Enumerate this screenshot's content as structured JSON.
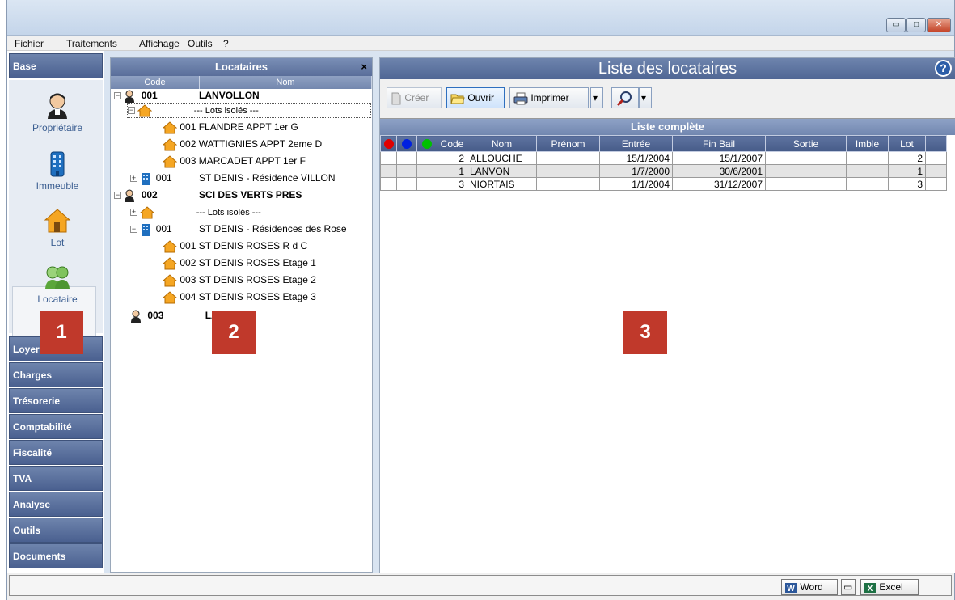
{
  "window": {
    "minimize": "▭",
    "maximize": "□",
    "close": "✕"
  },
  "menu": [
    "Fichier",
    "Traitements",
    "Affichage",
    "Outils",
    "?"
  ],
  "nav": {
    "base_label": "Base",
    "items": [
      {
        "label": "Propriétaire",
        "icon": "owner-icon"
      },
      {
        "label": "Immeuble",
        "icon": "building-icon"
      },
      {
        "label": "Lot",
        "icon": "house-icon"
      },
      {
        "label": "Locataire",
        "icon": "tenants-icon"
      }
    ],
    "sections": [
      "Loyers",
      "Charges",
      "Trésorerie",
      "Comptabilité",
      "Fiscalité",
      "TVA",
      "Analyse",
      "Outils",
      "Documents"
    ]
  },
  "tree": {
    "title": "Locataires",
    "close": "×",
    "col_code": "Code",
    "col_nom": "Nom",
    "rows": [
      {
        "code": "001",
        "name": "LANVOLLON"
      },
      {
        "name": "--- Lots isolés ---"
      },
      {
        "name": "001 FLANDRE APPT 1er G"
      },
      {
        "name": "002 WATTIGNIES APPT 2eme D"
      },
      {
        "name": "003 MARCADET APPT 1er F"
      },
      {
        "code": "001",
        "name": "ST DENIS - Résidence VILLON"
      },
      {
        "code": "002",
        "name": "SCI DES VERTS PRES"
      },
      {
        "name": "--- Lots isolés ---"
      },
      {
        "code": "001",
        "name": "ST DENIS - Résidences des Rose"
      },
      {
        "name": "001 ST DENIS ROSES R d C"
      },
      {
        "name": "002 ST DENIS ROSES Etage 1"
      },
      {
        "name": "003 ST DENIS ROSES Etage 2"
      },
      {
        "name": "004 ST DENIS ROSES Etage 3"
      },
      {
        "code": "003",
        "name": "LA"
      }
    ]
  },
  "main": {
    "title": "Liste des locataires",
    "help": "?",
    "toolbar": {
      "create": "Créer",
      "open": "Ouvrir",
      "print": "Imprimer",
      "dropdown": "▾"
    },
    "list_title": "Liste complète",
    "columns": [
      "Code",
      "Nom",
      "Prénom",
      "Entrée",
      "Fin Bail",
      "Sortie",
      "Imble",
      "Lot"
    ],
    "status_colors": [
      "#e00000",
      "#0020e0",
      "#00c000"
    ],
    "rows": [
      {
        "code": "2",
        "nom": "ALLOUCHE",
        "prenom": "",
        "entree": "15/1/2004",
        "fin": "15/1/2007",
        "sortie": "",
        "imble": "",
        "lot": "2"
      },
      {
        "code": "1",
        "nom": "LANVON",
        "prenom": "",
        "entree": "1/7/2000",
        "fin": "30/6/2001",
        "sortie": "",
        "imble": "",
        "lot": "1"
      },
      {
        "code": "3",
        "nom": "NIORTAIS",
        "prenom": "",
        "entree": "1/1/2004",
        "fin": "31/12/2007",
        "sortie": "",
        "imble": "",
        "lot": "3"
      }
    ]
  },
  "status": {
    "word": "Word",
    "excel": "Excel"
  },
  "badges": [
    "1",
    "2",
    "3"
  ]
}
